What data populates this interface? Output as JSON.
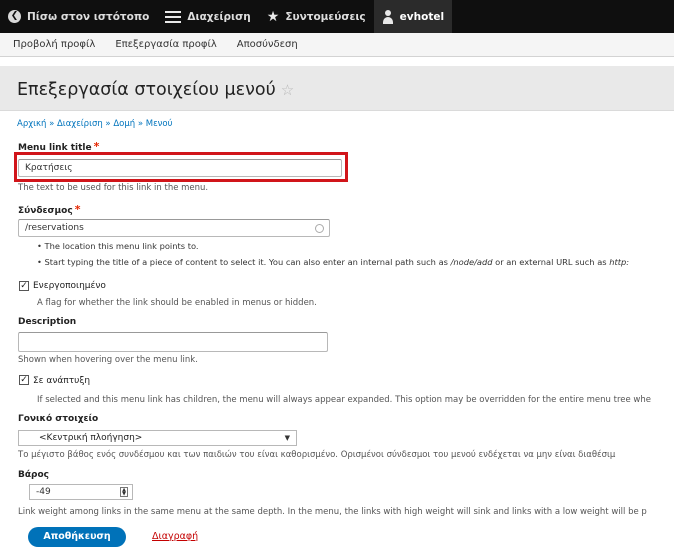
{
  "toolbar": {
    "back_label": "Πίσω στον ιστότοπο",
    "manage_label": "Διαχείριση",
    "shortcuts_label": "Συντομεύσεις",
    "user_label": "evhotel"
  },
  "tray": {
    "view_profile": "Προβολή προφίλ",
    "edit_profile": "Επεξεργασία προφίλ",
    "logout": "Αποσύνδεση"
  },
  "page": {
    "title": "Επεξεργασία στοιχείου μενού",
    "breadcrumb": "Αρχική » Διαχείριση » Δομή » Μενού"
  },
  "form": {
    "title_label": "Menu link title",
    "title_value": "Κρατήσεις",
    "title_desc": "The text to be used for this link in the menu.",
    "link_label": "Σύνδεσμος",
    "link_value": "/reservations",
    "link_bullet1": "The location this menu link points to.",
    "link_bullet2_a": "Start typing the title of a piece of content to select it. You can also enter an internal path such as ",
    "link_bullet2_em1": "/node/add",
    "link_bullet2_b": " or an external URL such as ",
    "link_bullet2_em2": "http:",
    "enabled_label": "Ενεργοποιημένο",
    "enabled_checked": true,
    "enabled_desc": "A flag for whether the link should be enabled in menus or hidden.",
    "description_label": "Description",
    "description_value": "",
    "description_desc": "Shown when hovering over the menu link.",
    "expanded_label": "Σε ανάπτυξη",
    "expanded_checked": true,
    "expanded_desc": "If selected and this menu link has children, the menu will always appear expanded. This option may be overridden for the entire menu tree whe",
    "parent_label": "Γονικό στοιχείο",
    "parent_value": "<Κεντρική πλοήγηση>",
    "parent_desc": "Το μέγιστο βάθος ενός συνδέσμου και των παιδιών του είναι καθορισμένο. Ορισμένοι σύνδεσμοι του μενού ενδέχεται να μην είναι διαθέσιμ",
    "weight_label": "Βάρος",
    "weight_value": "-49",
    "weight_desc": "Link weight among links in the same menu at the same depth. In the menu, the links with high weight will sink and links with a low weight will be p",
    "save_label": "Αποθήκευση",
    "delete_label": "Διαγραφή",
    "required_mark": "*"
  },
  "colors": {
    "toolbar_bg": "#0f0f0f",
    "accent_blue": "#0072b9",
    "required_red": "#e62600",
    "highlight_red": "#d1151a",
    "delete_red": "#c40000"
  }
}
